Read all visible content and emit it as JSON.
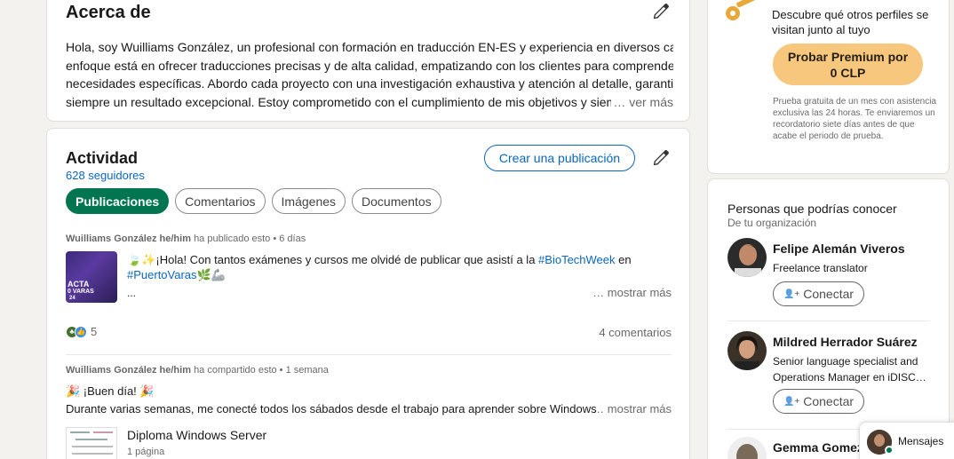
{
  "about": {
    "title": "Acerca de",
    "lines": [
      "Hola, soy Wuilliams González, un profesional con formación en traducción EN-ES y experiencia en diversos campos. Mi",
      "enfoque está en ofrecer traducciones precisas y de alta calidad, empatizando con los clientes para comprender sus",
      "necesidades específicas. Abordo cada proyecto con una investigación exhaustiva y atención al detalle, garantizando",
      "siempre un resultado excepcional. Estoy comprometido con el cumplimiento de mis objetivos y siempre busco :"
    ],
    "see_more": "… ver más"
  },
  "activity": {
    "title": "Actividad",
    "followers": "628 seguidores",
    "create_post": "Crear una publicación",
    "tabs": [
      "Publicaciones",
      "Comentarios",
      "Imágenes",
      "Documentos"
    ],
    "post1": {
      "author": "Wuilliams González he/him",
      "action": "ha publicado esto • 6 días",
      "text_prefix": "🍃✨¡Hola! Con tantos exámenes y cursos me olvidé de publicar que asistí a la ",
      "hashtag1": "#BioTechWeek",
      "text_mid": " en",
      "hashtag2": "#PuertoVaras",
      "text_suffix": "🌿🦾",
      "ellipsis": "...",
      "see_more": "… mostrar más",
      "reaction_count": "5",
      "comments": "4 comentarios",
      "thumb_text1": "ACTA",
      "thumb_text2": "0 VARAS",
      "thumb_text3": "24"
    },
    "post2": {
      "author": "Wuilliams González he/him",
      "action": "ha compartido esto • 1 semana",
      "line1": "🎉 ¡Buen día! 🎉",
      "line2": "Durante varias semanas, me conecté todos los sábados desde el trabajo para aprender sobre Windows Ser",
      "see_more": "… mostrar más",
      "doc_title": "Diploma Windows Server",
      "doc_pages": "1 página"
    }
  },
  "premium": {
    "desc": "Descubre qué otros perfiles se visitan junto al tuyo",
    "button_line1": "Probar Premium por",
    "button_line2": "0 CLP",
    "small": "Prueba gratuita de un mes con asistencia exclusiva las 24 horas. Te enviaremos un recordatorio siete días antes de que acabe el periodo de prueba.",
    "accent": "#f8c77e"
  },
  "people": {
    "title": "Personas que podrías conocer",
    "subtitle": "De tu organización",
    "connect_label": "Conectar",
    "items": [
      {
        "name": "Felipe Alemán Viveros",
        "headline": "Freelance translator"
      },
      {
        "name": "Mildred Herrador Suárez",
        "headline": "Senior language specialist and Operations Manager en iDISC…"
      },
      {
        "name": "Gemma Gomez",
        "headline": ""
      }
    ]
  },
  "messaging": {
    "label": "Mensajes"
  },
  "colors": {
    "link": "#0a66c2",
    "active_pill": "#01754f",
    "background": "#f4f2ee"
  }
}
